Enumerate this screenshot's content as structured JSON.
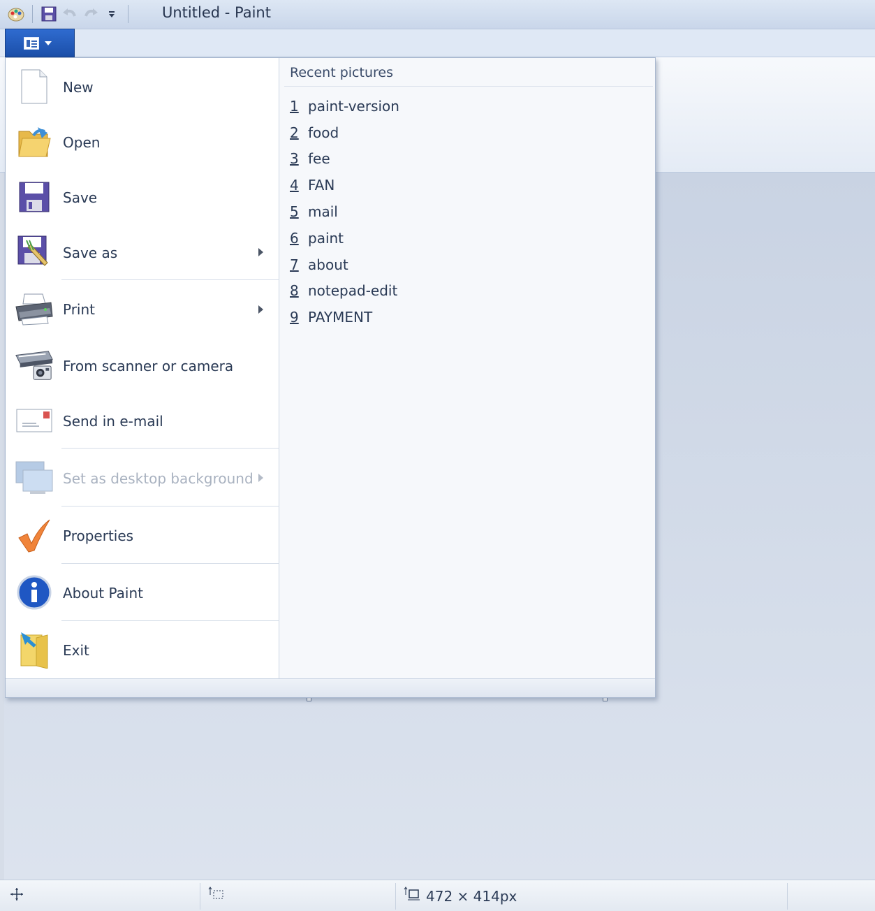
{
  "window": {
    "title": "Untitled - Paint"
  },
  "quick_access": [
    {
      "icon": "paint-app-icon"
    },
    {
      "icon": "save-icon"
    },
    {
      "icon": "undo-icon"
    },
    {
      "icon": "redo-icon"
    },
    {
      "icon": "customize-toolbar-icon"
    }
  ],
  "file_button": {
    "icon": "file-menu-icon"
  },
  "menu": {
    "items": [
      {
        "label": "New",
        "icon": "new-document-icon"
      },
      {
        "label": "Open",
        "icon": "open-folder-icon"
      },
      {
        "label": "Save",
        "icon": "floppy-disk-icon"
      },
      {
        "label": "Save as",
        "icon": "save-as-icon"
      },
      {
        "label": "Print",
        "icon": "printer-icon"
      },
      {
        "label": "From scanner or camera",
        "icon": "scanner-camera-icon"
      },
      {
        "label": "Send in e-mail",
        "icon": "email-envelope-icon"
      },
      {
        "label": "Set as desktop background",
        "icon": "desktop-background-icon"
      },
      {
        "label": "Properties",
        "icon": "checkmark-icon"
      },
      {
        "label": "About Paint",
        "icon": "info-icon"
      },
      {
        "label": "Exit",
        "icon": "exit-icon"
      }
    ],
    "recent": {
      "heading": "Recent pictures",
      "items": [
        {
          "num": "1",
          "name": "paint-version"
        },
        {
          "num": "2",
          "name": "food"
        },
        {
          "num": "3",
          "name": "fee"
        },
        {
          "num": "4",
          "name": "FAN"
        },
        {
          "num": "5",
          "name": "mail"
        },
        {
          "num": "6",
          "name": "paint"
        },
        {
          "num": "7",
          "name": "about"
        },
        {
          "num": "8",
          "name": "notepad-edit"
        },
        {
          "num": "9",
          "name": "PAYMENT"
        }
      ]
    }
  },
  "statusbar": {
    "cursor_icon": "move-cursor-icon",
    "selection_icon": "selection-size-icon",
    "canvas_icon": "canvas-size-icon",
    "canvas_size": "472 × 414px"
  }
}
